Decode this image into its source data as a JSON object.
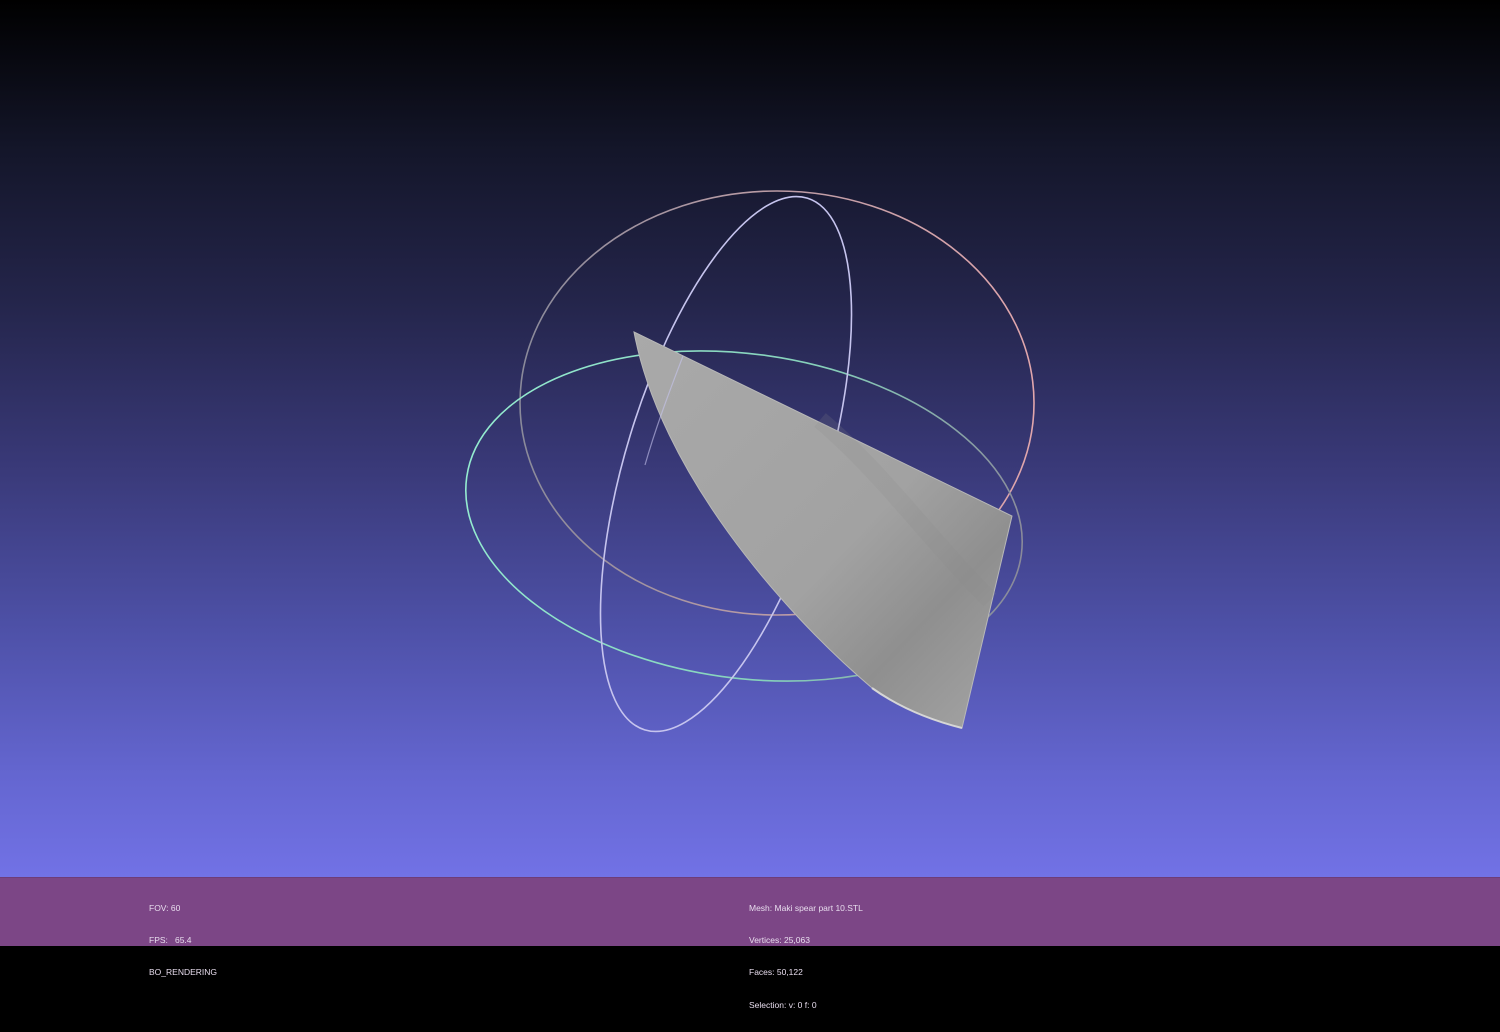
{
  "viewer": {
    "name": "MeshLab",
    "background": {
      "top": "#000000",
      "bottom": "#7272e6"
    },
    "trackball": {
      "ring_colors": {
        "outer": "#d79a9e",
        "vertical": "#c8c6f0",
        "horizontal": "#8ee0c6",
        "inactive": "#8a8a9a"
      }
    },
    "mesh_color": "#a3a3a3"
  },
  "status": {
    "bar_color": "#7c4686",
    "left": {
      "fov": "FOV: 60",
      "fps": "FPS:   65.4",
      "mode": "BO_RENDERING"
    },
    "right": {
      "mesh": "Mesh: Maki spear part 10.STL",
      "vertices": "Vertices: 25,063",
      "faces": "Faces: 50,122",
      "selection": "Selection: v: 0 f: 0"
    }
  }
}
